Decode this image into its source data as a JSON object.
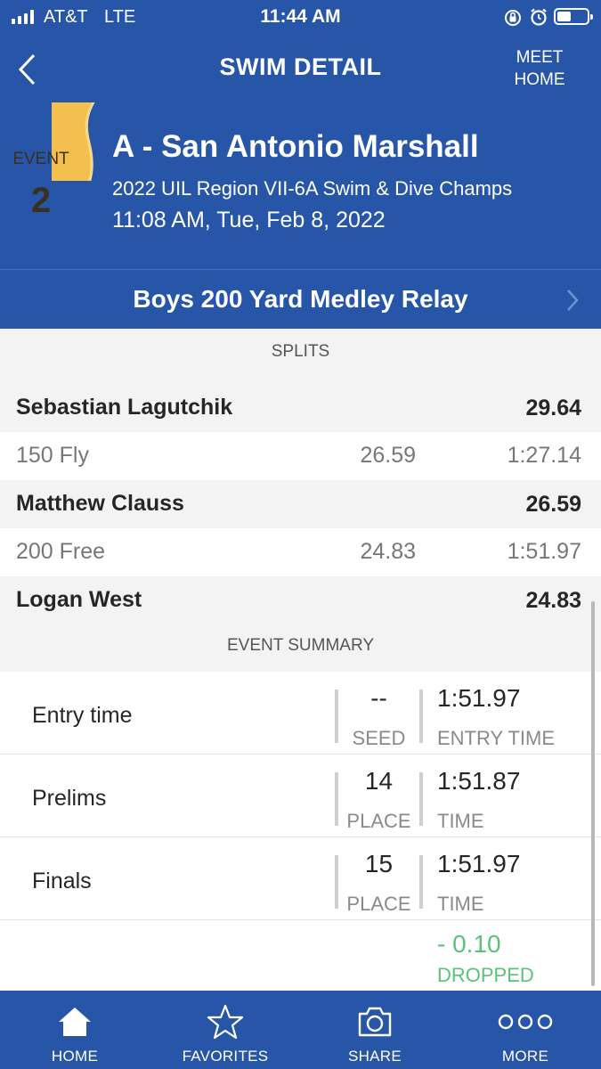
{
  "status_bar": {
    "carrier": "AT&T",
    "network": "LTE",
    "time": "11:44 AM"
  },
  "nav": {
    "title": "SWIM DETAIL",
    "right_line1": "MEET",
    "right_line2": "HOME"
  },
  "event": {
    "label": "EVENT",
    "number": "2",
    "team": "A - San Antonio Marshall",
    "meet": "2022 UIL Region VII-6A Swim & Dive Champs",
    "datetime": "11:08 AM, Tue, Feb 8, 2022",
    "name": "Boys 200 Yard Medley Relay"
  },
  "splits": {
    "header": "SPLITS",
    "swimmers": [
      {
        "name": "Sebastian Lagutchik",
        "split": "29.64"
      },
      {
        "name": "Matthew Clauss",
        "split": "26.59"
      },
      {
        "name": "Logan West",
        "split": "24.83"
      }
    ],
    "legs": [
      {
        "distance": "150 Fly",
        "lap": "26.59",
        "cumulative": "1:27.14"
      },
      {
        "distance": "200 Free",
        "lap": "24.83",
        "cumulative": "1:51.97"
      }
    ]
  },
  "summary": {
    "header": "EVENT SUMMARY",
    "rows": [
      {
        "label": "Entry time",
        "mid_value": "--",
        "mid_caption": "SEED",
        "right_value": "1:51.97",
        "right_caption": "ENTRY TIME"
      },
      {
        "label": "Prelims",
        "mid_value": "14",
        "mid_caption": "PLACE",
        "right_value": "1:51.87",
        "right_caption": "TIME"
      },
      {
        "label": "Finals",
        "mid_value": "15",
        "mid_caption": "PLACE",
        "right_value": "1:51.97",
        "right_caption": "TIME"
      }
    ],
    "dropped_value": "- 0.10",
    "dropped_caption": "DROPPED"
  },
  "tabs": [
    {
      "label": "HOME",
      "icon": "home-icon"
    },
    {
      "label": "FAVORITES",
      "icon": "star-icon"
    },
    {
      "label": "SHARE",
      "icon": "camera-icon"
    },
    {
      "label": "MORE",
      "icon": "more-icon"
    }
  ],
  "colors": {
    "primary_blue": "#2756a8",
    "event_badge_gold": "#f3c04f",
    "dropped_green": "#5bc27a"
  }
}
